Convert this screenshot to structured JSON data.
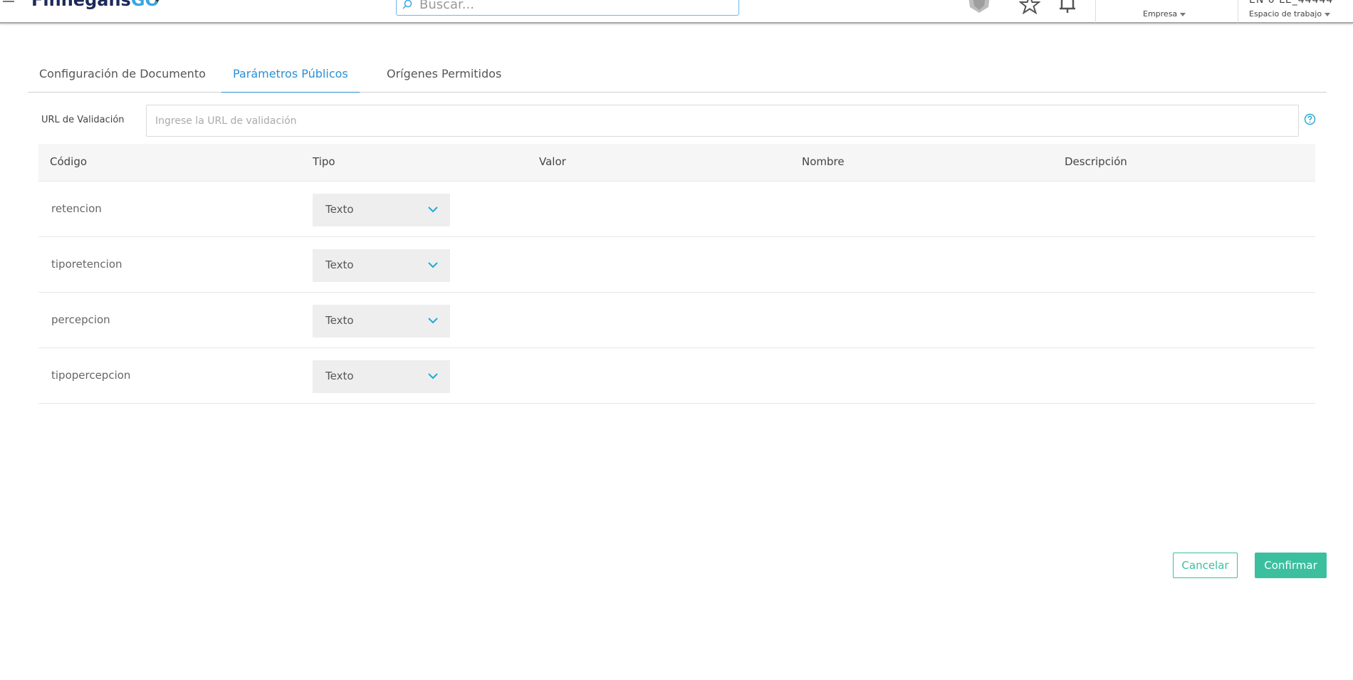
{
  "header": {
    "logo_main": "Finnegans",
    "logo_accent": "GO",
    "search_placeholder": "Buscar...",
    "top_right_text": "EN 0 LE_44444",
    "company_label": "Empresa",
    "workspace_label": "Espacio de trabajo"
  },
  "tabs": [
    {
      "label": "Configuración de Documento",
      "active": false
    },
    {
      "label": "Parámetros Públicos",
      "active": true
    },
    {
      "label": "Orígenes Permitidos",
      "active": false
    }
  ],
  "url_field": {
    "label": "URL de Validación",
    "placeholder": "Ingrese la URL de validación",
    "value": ""
  },
  "table": {
    "columns": [
      "Código",
      "Tipo",
      "Valor",
      "Nombre",
      "Descripción"
    ],
    "rows": [
      {
        "codigo": "retencion",
        "tipo": "Texto"
      },
      {
        "codigo": "tiporetencion",
        "tipo": "Texto"
      },
      {
        "codigo": "percepcion",
        "tipo": "Texto"
      },
      {
        "codigo": "tipopercepcion",
        "tipo": "Texto"
      }
    ]
  },
  "buttons": {
    "cancel": "Cancelar",
    "confirm": "Confirmar"
  },
  "colors": {
    "accent_blue": "#2a8fd4",
    "accent_green": "#3bbf9f",
    "chevron": "#1fa9d6"
  }
}
